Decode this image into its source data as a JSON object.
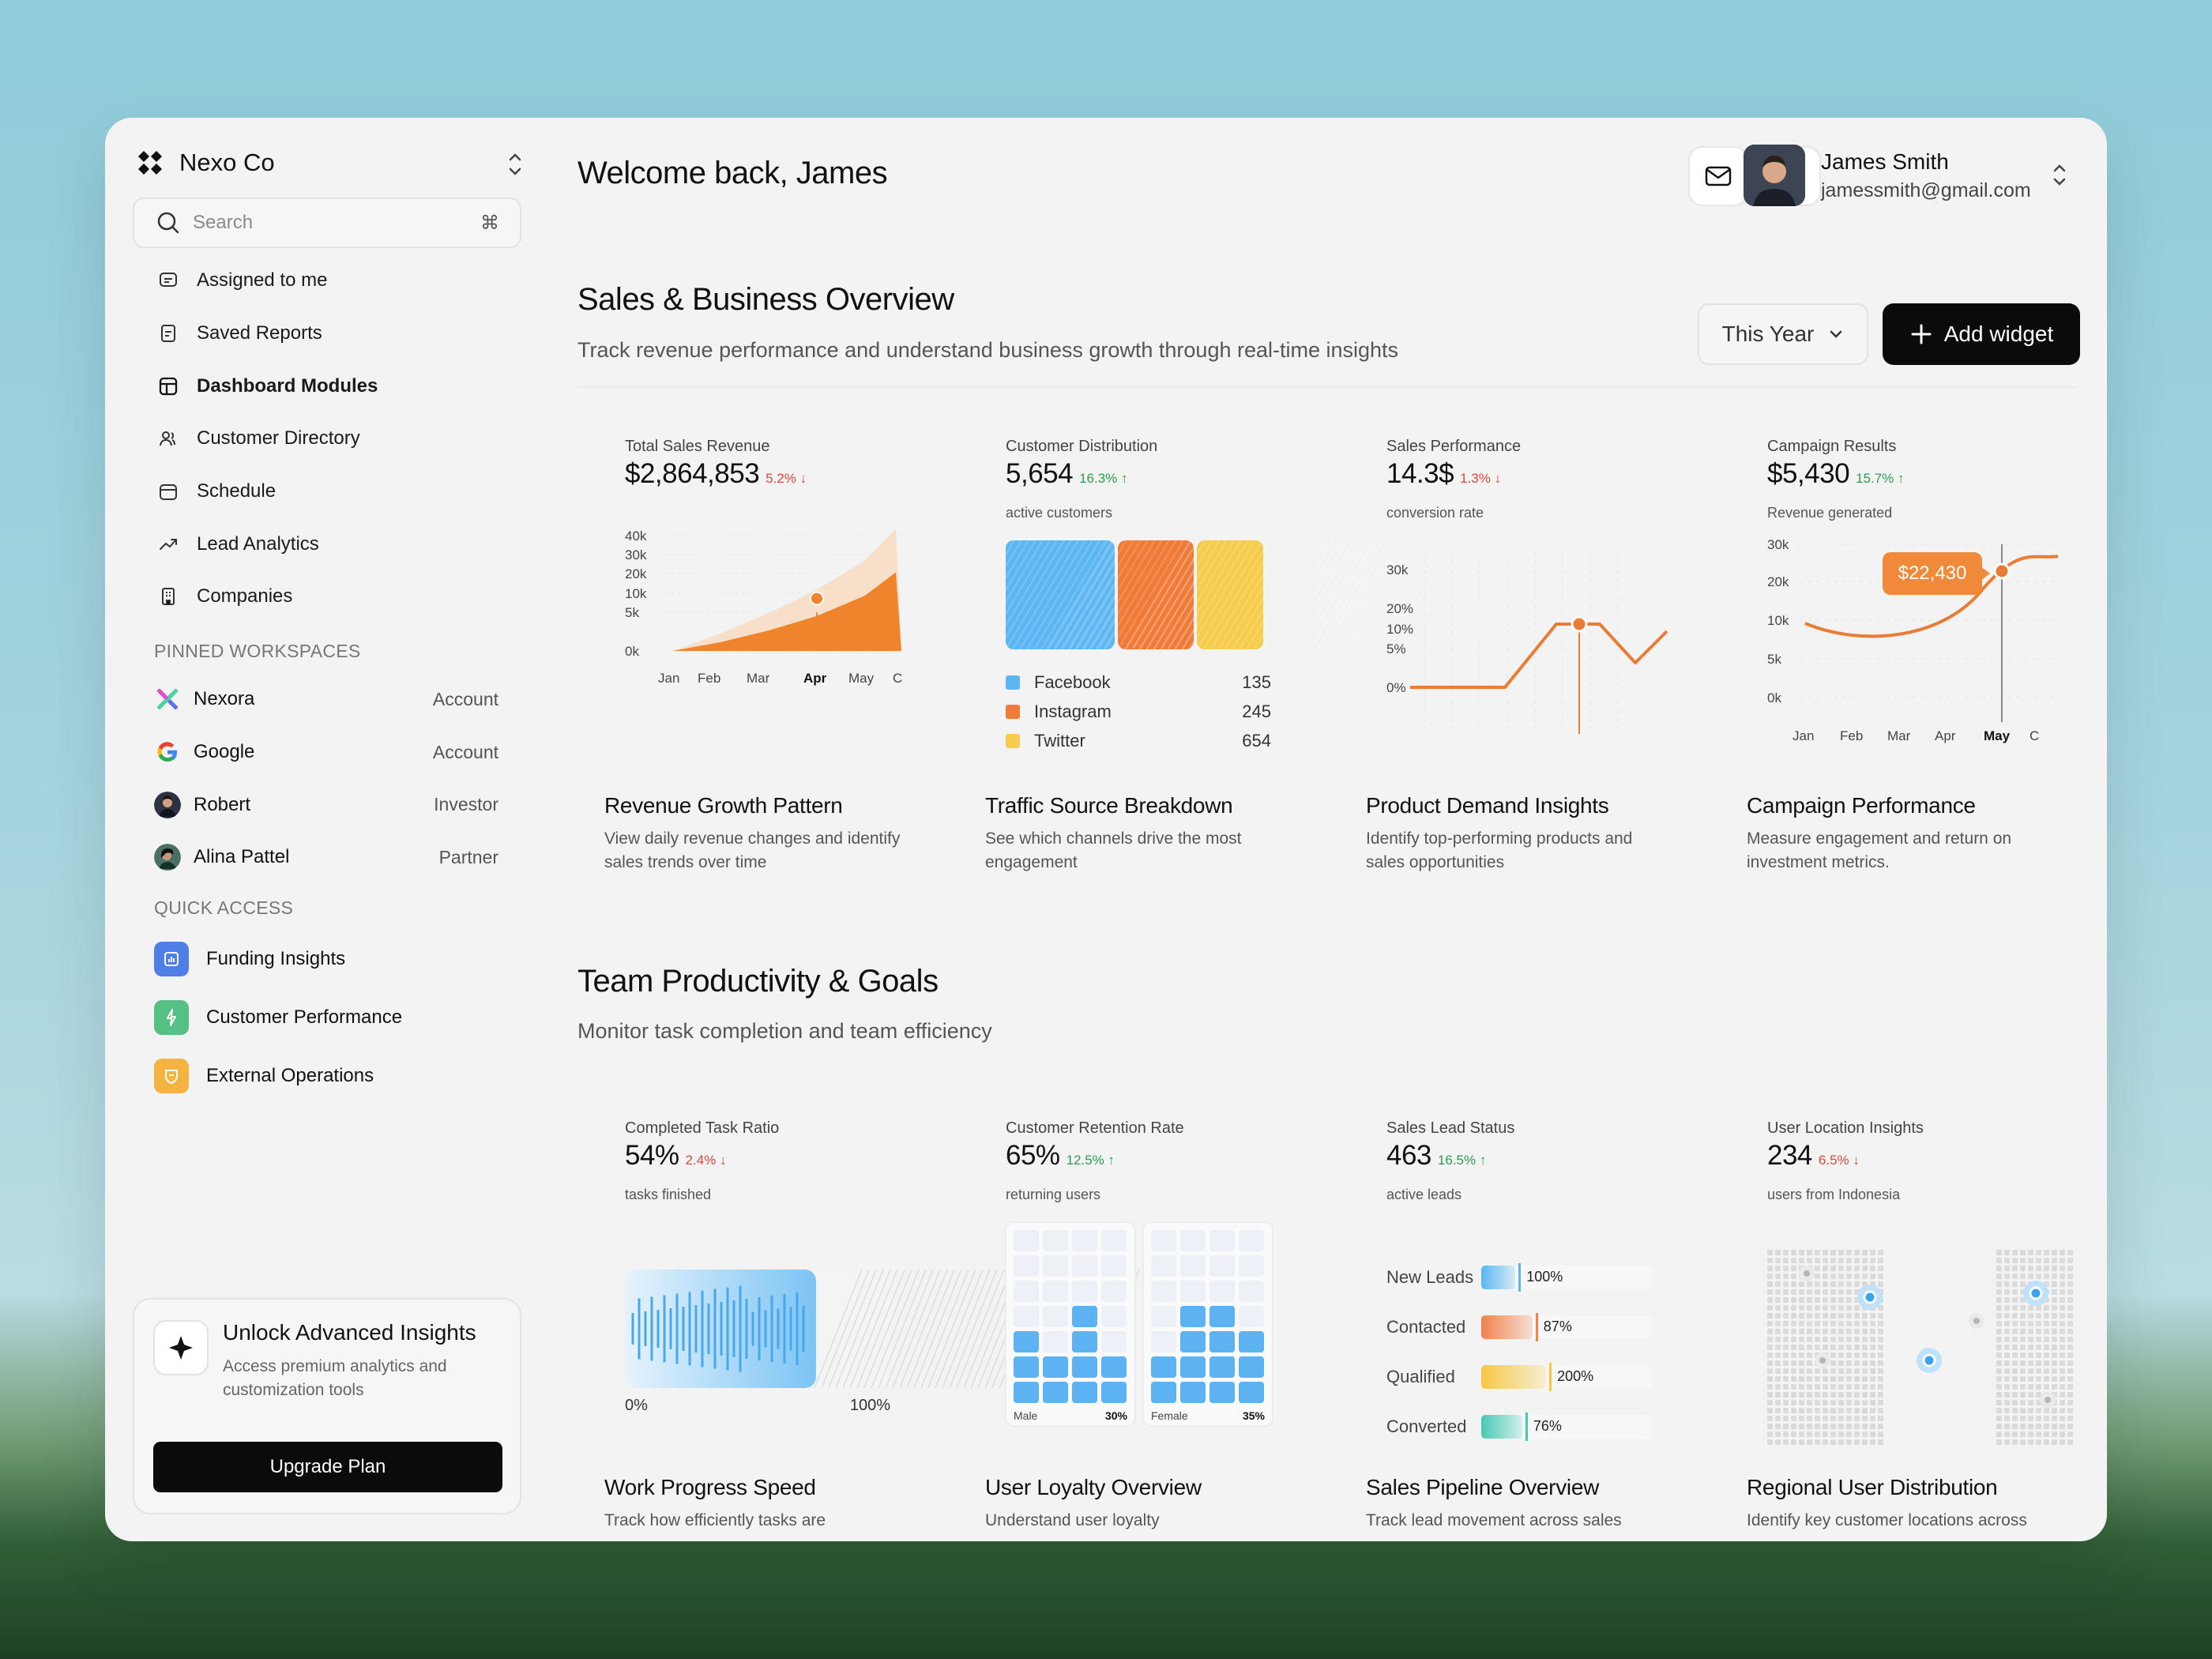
{
  "brand": {
    "name": "Nexo Co"
  },
  "search": {
    "placeholder": "Search",
    "shortcut": "⌘"
  },
  "nav": [
    {
      "label": "Assigned to me",
      "icon": "chat-icon"
    },
    {
      "label": "Saved Reports",
      "icon": "report-icon"
    },
    {
      "label": "Dashboard Modules",
      "icon": "dashboard-icon",
      "active": true
    },
    {
      "label": "Customer Directory",
      "icon": "users-icon"
    },
    {
      "label": "Schedule",
      "icon": "calendar-icon"
    },
    {
      "label": "Lead Analytics",
      "icon": "trend-icon"
    },
    {
      "label": "Companies",
      "icon": "building-icon"
    }
  ],
  "pinned": {
    "title": "PINNED WORKSPACES",
    "items": [
      {
        "name": "Nexora",
        "role": "Account"
      },
      {
        "name": "Google",
        "role": "Account"
      },
      {
        "name": "Robert",
        "role": "Investor"
      },
      {
        "name": "Alina Pattel",
        "role": "Partner"
      }
    ]
  },
  "quick": {
    "title": "QUICK ACCESS",
    "items": [
      {
        "label": "Funding Insights",
        "color": "#4f7fe6"
      },
      {
        "label": "Customer Performance",
        "color": "#55c083"
      },
      {
        "label": "External Operations",
        "color": "#f5b441"
      }
    ]
  },
  "promo": {
    "title": "Unlock Advanced Insights",
    "desc": "Access premium analytics and customization tools",
    "button": "Upgrade Plan"
  },
  "header": {
    "welcome": "Welcome back, James"
  },
  "user": {
    "name": "James Smith",
    "email": "jamessmith@gmail.com"
  },
  "overview": {
    "title": "Sales & Business Overview",
    "subtitle": "Track revenue performance and understand business growth through real-time insights",
    "period": "This Year",
    "add": "Add widget"
  },
  "cards1": [
    {
      "label": "Total Sales Revenue",
      "value": "$2,864,853",
      "change": "5.2%",
      "dir": "down",
      "note": "",
      "title": "Revenue Growth Pattern",
      "desc": "View daily revenue changes and identify sales trends over time"
    },
    {
      "label": "Customer Distribution",
      "value": "5,654",
      "change": "16.3%",
      "dir": "up",
      "note": "active customers",
      "title": "Traffic Source Breakdown",
      "desc": "See which channels drive the most engagement"
    },
    {
      "label": "Sales Performance",
      "value": "14.3$",
      "change": "1.3%",
      "dir": "down",
      "note": "conversion rate",
      "title": "Product Demand Insights",
      "desc": "Identify top-performing products and sales opportunities"
    },
    {
      "label": "Campaign Results",
      "value": "$5,430",
      "change": "15.7%",
      "dir": "up",
      "note": "Revenue generated",
      "title": "Campaign Performance",
      "desc": "Measure engagement and return on investment metrics."
    }
  ],
  "team": {
    "title": "Team Productivity & Goals",
    "subtitle": "Monitor task completion and team efficiency"
  },
  "cards2": [
    {
      "label": "Completed Task Ratio",
      "value": "54%",
      "change": "2.4%",
      "dir": "down",
      "note": "tasks finished",
      "title": "Work Progress Speed",
      "desc": "Track how efficiently tasks are"
    },
    {
      "label": "Customer Retention Rate",
      "value": "65%",
      "change": "12.5%",
      "dir": "up",
      "note": "returning users",
      "title": "User Loyalty Overview",
      "desc": "Understand user loyalty"
    },
    {
      "label": "Sales Lead Status",
      "value": "463",
      "change": "16.5%",
      "dir": "up",
      "note": "active leads",
      "title": "Sales Pipeline Overview",
      "desc": "Track lead movement across sales"
    },
    {
      "label": "User Location Insights",
      "value": "234",
      "change": "6.5%",
      "dir": "down",
      "note": "users from Indonesia",
      "title": "Regional User Distribution",
      "desc": "Identify key customer locations across"
    }
  ],
  "chart_data": [
    {
      "type": "area",
      "title": "Total Sales Revenue",
      "categories": [
        "Jan",
        "Feb",
        "Mar",
        "Apr",
        "May",
        "C"
      ],
      "highlight": "Apr",
      "yticks": [
        "0k",
        "5k",
        "10k",
        "20k",
        "30k",
        "40k"
      ],
      "series": [
        {
          "values": [
            0,
            6,
            13,
            21,
            31,
            42
          ]
        },
        {
          "values": [
            0,
            3,
            7,
            12,
            19,
            27
          ]
        }
      ]
    },
    {
      "type": "bar",
      "title": "Customer Distribution",
      "categories": [
        "Facebook",
        "Instagram",
        "Twitter"
      ],
      "values": [
        135,
        245,
        654
      ],
      "colors": [
        "#5cb6f2",
        "#f07a37",
        "#f6cc4c"
      ]
    },
    {
      "type": "line",
      "title": "Sales Performance",
      "yticks": [
        "0%",
        "5%",
        "10%",
        "20%",
        "30k"
      ],
      "points": [
        0,
        0,
        0,
        0,
        10,
        10,
        10,
        4,
        8
      ],
      "highlight_index": 4
    },
    {
      "type": "line",
      "title": "Campaign Results",
      "categories": [
        "Jan",
        "Feb",
        "Mar",
        "Apr",
        "May",
        "C"
      ],
      "highlight": "May",
      "yticks": [
        "0k",
        "5k",
        "10k",
        "20k",
        "30k"
      ],
      "tooltip": "$22,430"
    },
    {
      "type": "bar",
      "title": "Completed Task Ratio",
      "min_label": "0%",
      "max_label": "100%",
      "progress": 0.72
    },
    {
      "type": "bar",
      "title": "Customer Retention Rate",
      "groups": [
        {
          "name": "Male",
          "value": "30%"
        },
        {
          "name": "Female",
          "value": "35%"
        }
      ]
    },
    {
      "type": "bar",
      "title": "Sales Lead Status",
      "categories": [
        "New Leads",
        "Contacted",
        "Qualified",
        "Converted"
      ],
      "values": [
        "100%",
        "87%",
        "200%",
        "76%"
      ],
      "fill": [
        0.2,
        0.3,
        0.38,
        0.24
      ],
      "colors": [
        "#58b6f0",
        "#f0824a",
        "#f6c843",
        "#46c9b4"
      ]
    }
  ]
}
